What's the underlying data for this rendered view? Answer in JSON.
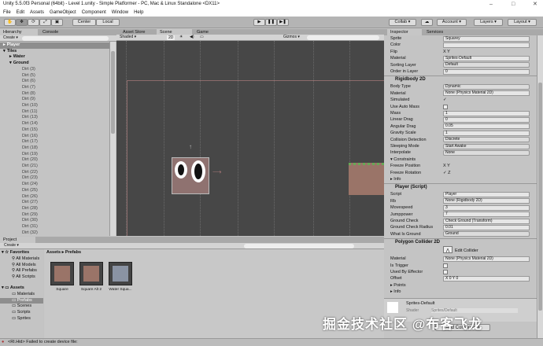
{
  "window": {
    "title": "Unity 5.5.0f3 Personal (64bit) - Level 1.unity - Simple Platformer - PC, Mac & Linux Standalone <DX11>",
    "minimize": "–",
    "maximize": "□",
    "close": "✕"
  },
  "menu": [
    "File",
    "Edit",
    "Assets",
    "GameObject",
    "Component",
    "Window",
    "Help"
  ],
  "toolbar": {
    "center": "Center",
    "local": "Local",
    "play": "▶",
    "pause": "❚❚",
    "step": "▶❚",
    "collab": "Collab ▾",
    "account": "Account ▾",
    "layers": "Layers ▾",
    "layout": "Layout ▾"
  },
  "hierarchy": {
    "tab": "Hierarchy",
    "console_tab": "Console",
    "create": "Create ▾",
    "items": [
      {
        "label": "Player",
        "depth": 0,
        "selected": true,
        "arrow": "▸"
      },
      {
        "label": "Tiles",
        "depth": 0,
        "arrow": "▾"
      },
      {
        "label": "Water",
        "depth": 1,
        "arrow": "▸"
      },
      {
        "label": "Ground",
        "depth": 1,
        "arrow": "▾"
      }
    ],
    "dirt": [
      "Dirt (3)",
      "Dirt (5)",
      "Dirt (6)",
      "Dirt (7)",
      "Dirt (8)",
      "Dirt (9)",
      "Dirt (10)",
      "Dirt (11)",
      "Dirt (13)",
      "Dirt (14)",
      "Dirt (15)",
      "Dirt (16)",
      "Dirt (17)",
      "Dirt (18)",
      "Dirt (19)",
      "Dirt (20)",
      "Dirt (21)",
      "Dirt (22)",
      "Dirt (23)",
      "Dirt (24)",
      "Dirt (25)",
      "Dirt (26)",
      "Dirt (27)",
      "Dirt (28)",
      "Dirt (29)",
      "Dirt (30)",
      "Dirt (31)",
      "Dirt (32)"
    ]
  },
  "scene": {
    "tabs": [
      "Asset Store",
      "Scene",
      "Game"
    ],
    "shading": "Shaded ▾",
    "mode_2d": "2D",
    "gizmos": "Gizmos ▾"
  },
  "inspector": {
    "tab": "Inspector",
    "services_tab": "Services",
    "sprite_renderer": [
      {
        "label": "Sprite",
        "value": "Squarey"
      },
      {
        "label": "Color",
        "value": ""
      },
      {
        "label": "Flip",
        "check": "X  Y"
      },
      {
        "label": "Material",
        "value": "Sprites-Default"
      },
      {
        "label": "Sorting Layer",
        "value": "Default",
        "dd": true
      },
      {
        "label": "Order in Layer",
        "value": "0"
      }
    ],
    "rigidbody": {
      "title": "Rigidbody 2D",
      "rows": [
        {
          "label": "Body Type",
          "value": "Dynamic",
          "dd": true
        },
        {
          "label": "Material",
          "value": "None (Physics Material 2D)"
        },
        {
          "label": "Simulated",
          "check": "✓"
        },
        {
          "label": "Use Auto Mass",
          "check": ""
        },
        {
          "label": "Mass",
          "value": "1"
        },
        {
          "label": "Linear Drag",
          "value": "0"
        },
        {
          "label": "Angular Drag",
          "value": "0.05"
        },
        {
          "label": "Gravity Scale",
          "value": "1"
        },
        {
          "label": "Collision Detection",
          "value": "Discrete",
          "dd": true
        },
        {
          "label": "Sleeping Mode",
          "value": "Start Awake",
          "dd": true
        },
        {
          "label": "Interpolate",
          "value": "None",
          "dd": true
        },
        {
          "label": "▾ Constraints"
        },
        {
          "label": "   Freeze Position",
          "check": "X  Y"
        },
        {
          "label": "   Freeze Rotation",
          "check": "✓ Z"
        },
        {
          "label": "▸ Info"
        }
      ]
    },
    "player_script": {
      "title": "Player (Script)",
      "rows": [
        {
          "label": "Script",
          "value": "Player"
        },
        {
          "label": "Rb",
          "value": "None (Rigidbody 2D)"
        },
        {
          "label": "Movespeed",
          "value": "3"
        },
        {
          "label": "Jumppower",
          "value": "7"
        },
        {
          "label": "Ground Check",
          "value": "Check Ground (Transform)"
        },
        {
          "label": "Ground Check Radius",
          "value": "0.01"
        },
        {
          "label": "What Is Ground",
          "value": "Ground",
          "dd": true
        }
      ]
    },
    "polygon_collider": {
      "title": "Polygon Collider 2D",
      "edit": "Edit Collider",
      "rows": [
        {
          "label": "Material",
          "value": "None (Physics Material 2D)"
        },
        {
          "label": "Is Trigger",
          "check": ""
        },
        {
          "label": "Used By Effector",
          "check": ""
        },
        {
          "label": "Offset",
          "value": "X 0          Y 0"
        },
        {
          "label": "▸ Points"
        },
        {
          "label": "▸ Info"
        }
      ]
    },
    "material": {
      "name": "Sprites-Default",
      "shader_label": "Shader",
      "shader": "Sprites/Default"
    },
    "add_component": "Add Component"
  },
  "project": {
    "tab": "Project",
    "create": "Create ▾",
    "breadcrumb": "Assets ▸ Prefabs",
    "favorites": {
      "label": "Favorites",
      "items": [
        "All Materials",
        "All Models",
        "All Prefabs",
        "All Scripts"
      ]
    },
    "assets": {
      "label": "Assets",
      "items": [
        "Materials",
        "Prefabs",
        "Scenes",
        "Scripts",
        "Sprites"
      ],
      "selected": "Prefabs"
    },
    "files": [
      {
        "name": "Square",
        "color": "#9a7468"
      },
      {
        "name": "Square Alt 2",
        "color": "#9a7468"
      },
      {
        "name": "Water Squa...",
        "color": "#8a93a3"
      }
    ]
  },
  "status": "<RI.Hid> Failed to create device file:",
  "watermark": "掘金技术社区 @布客飞龙"
}
